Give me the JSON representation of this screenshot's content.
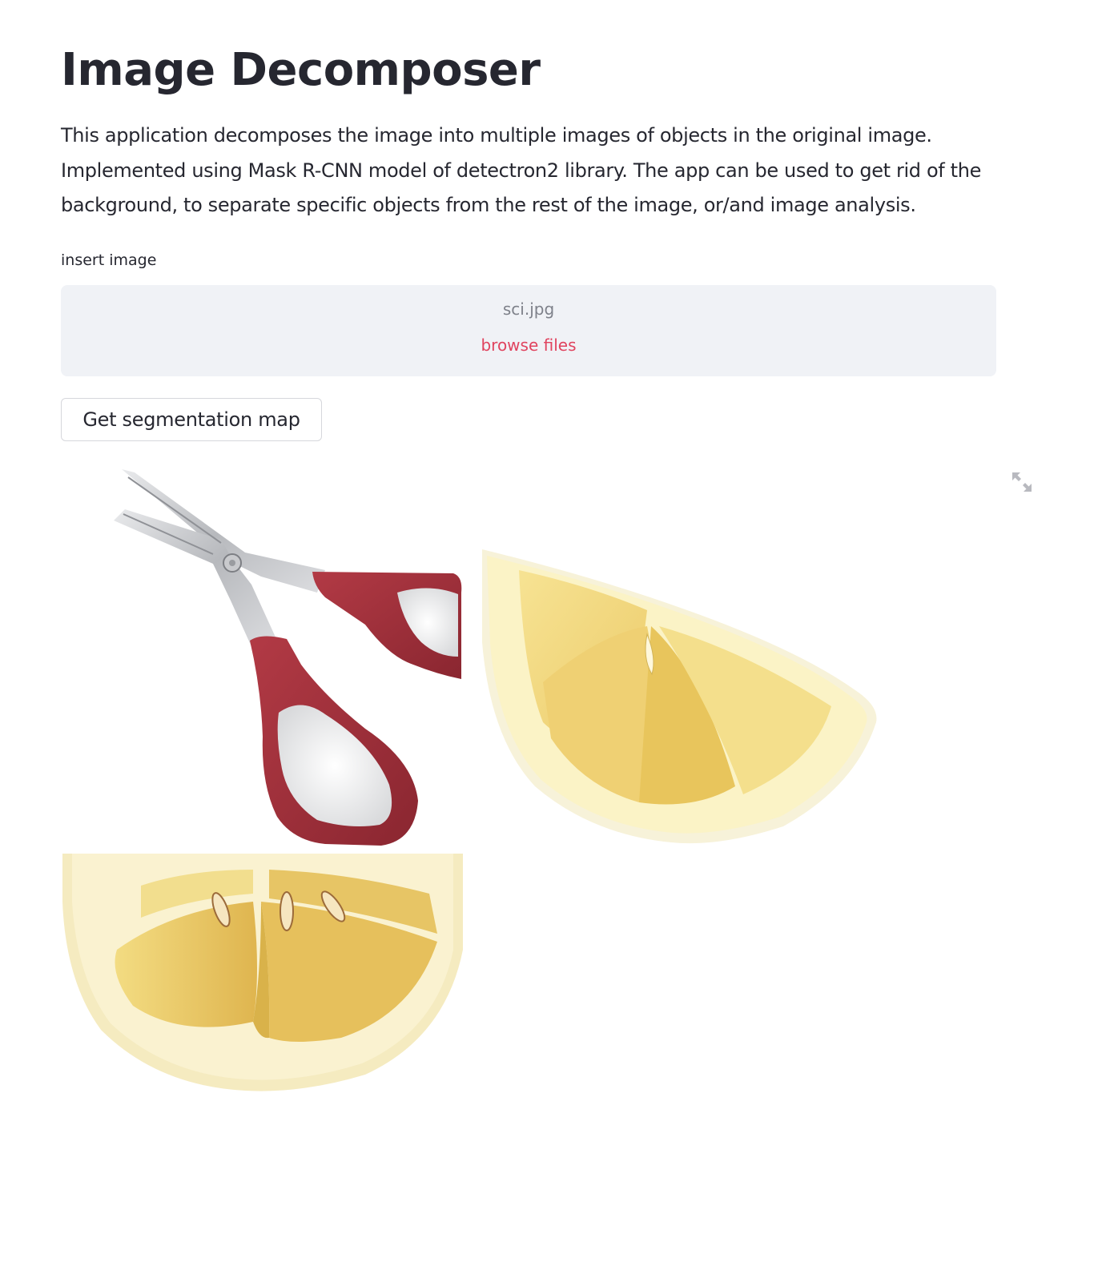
{
  "page": {
    "title": "Image Decomposer",
    "description": "This application decomposes the image into multiple images of objects in the original image. Implemented using Mask R-CNN model of detectron2 library. The app can be used to get rid of the background, to separate specific objects from the rest of the image, or/and image analysis."
  },
  "uploader": {
    "label": "insert image",
    "file_name": "sci.jpg",
    "browse_label": "browse files"
  },
  "actions": {
    "segment_button": "Get segmentation map"
  },
  "output": {
    "images": [
      {
        "name": "scissors-image",
        "object": "scissors"
      },
      {
        "name": "lemon-wedge-image",
        "object": "lemon slice"
      },
      {
        "name": "lemon-half-image",
        "object": "lemon half"
      }
    ],
    "fullscreen_icon": "expand-icon"
  },
  "colors": {
    "accent": "#e0445f",
    "text": "#262730",
    "dropzone_bg": "#f0f2f6",
    "handle_red": "#9e2c38",
    "lemon_yellow": "#f2d66b"
  }
}
